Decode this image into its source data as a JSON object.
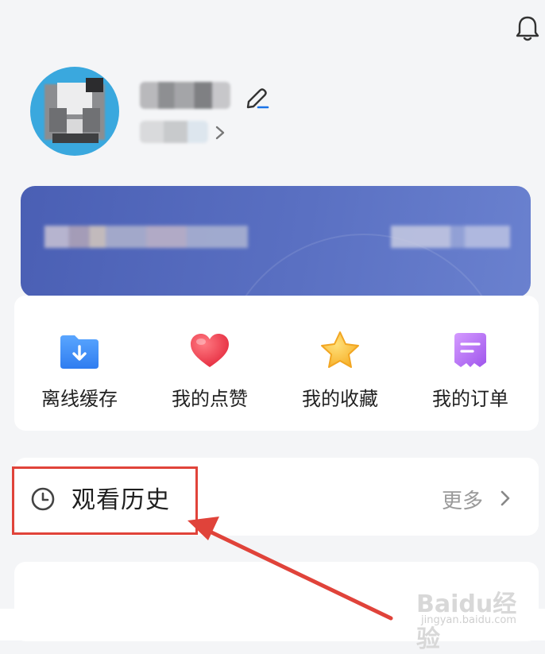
{
  "header": {
    "bell_icon": "bell-icon"
  },
  "profile": {
    "avatar_icon": "avatar-blurred",
    "edit_icon": "pencil-icon"
  },
  "quick_actions": [
    {
      "label": "离线缓存",
      "icon": "folder-download-icon",
      "color": "#3f8ef5"
    },
    {
      "label": "我的点赞",
      "icon": "heart-icon",
      "color": "#ef3b4a"
    },
    {
      "label": "我的收藏",
      "icon": "star-icon",
      "color": "#f7b92e"
    },
    {
      "label": "我的订单",
      "icon": "order-icon",
      "color": "#b06cf0"
    }
  ],
  "history": {
    "title": "观看历史",
    "more_label": "更多",
    "icon": "clock-icon"
  },
  "watermark": {
    "main": "Baidu经验",
    "sub": "jingyan.baidu.com"
  },
  "colors": {
    "banner": "#5266bb",
    "annotation": "#e0433a",
    "accent_blue": "#1a73e8"
  }
}
